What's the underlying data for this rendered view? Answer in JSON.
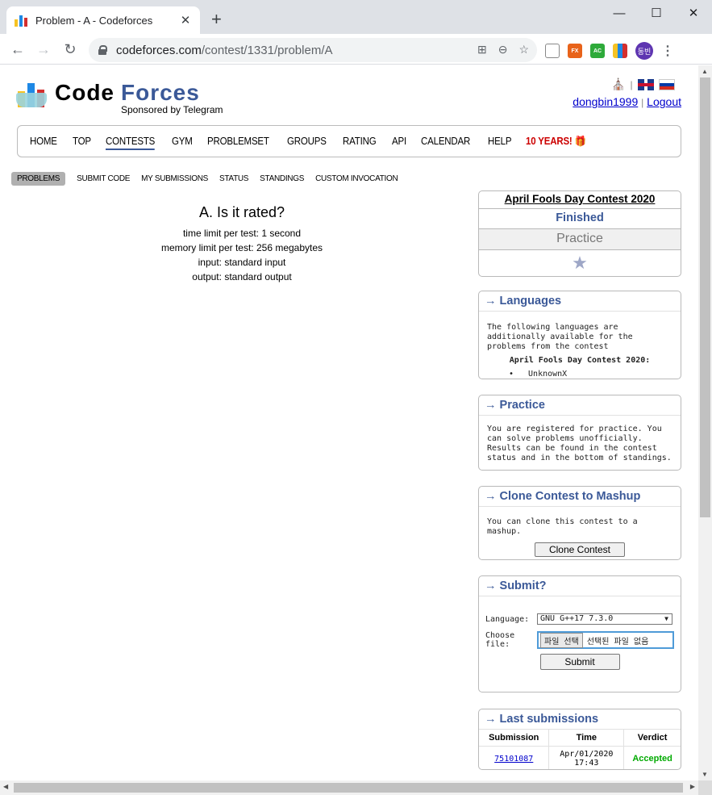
{
  "browser": {
    "tab_title": "Problem - A - Codeforces",
    "url_host": "codeforces.com",
    "url_path": "/contest/1331/problem/A",
    "profile_initials": "동빈",
    "ext_fx": "FX",
    "ext_ac": "AC"
  },
  "header": {
    "logo_code": "Code",
    "logo_forces": "Forces",
    "logo_sponsor": "Sponsored by Telegram",
    "separator": "|",
    "username": "dongbin1999",
    "logout": "Logout"
  },
  "main_menu": [
    "HOME",
    "TOP",
    "CONTESTS",
    "GYM",
    "PROBLEMSET",
    "GROUPS",
    "RATING",
    "API",
    "CALENDAR",
    "HELP"
  ],
  "main_menu_special": "10 YEARS! 🎁",
  "sub_menu": [
    "PROBLEMS",
    "SUBMIT CODE",
    "MY SUBMISSIONS",
    "STATUS",
    "STANDINGS",
    "CUSTOM INVOCATION"
  ],
  "problem": {
    "title": "A. Is it rated?",
    "time_limit": "time limit per test: 1 second",
    "memory_limit": "memory limit per test: 256 megabytes",
    "input": "input: standard input",
    "output": "output: standard output"
  },
  "contest_box": {
    "name": "April Fools Day Contest 2020",
    "status": "Finished",
    "phase": "Practice"
  },
  "languages_box": {
    "caption": "→ Languages",
    "text": "The following languages are additionally available for the problems from the contest",
    "subheading": "April Fools Day Contest 2020:",
    "item": "UnknownX"
  },
  "practice_box": {
    "caption": "→ Practice",
    "text": "You are registered for practice. You can solve problems unofficially. Results can be found in the contest status and in the bottom of standings."
  },
  "clone_box": {
    "caption": "→ Clone Contest to Mashup",
    "text": "You can clone this contest to a mashup.",
    "button": "Clone Contest"
  },
  "submit_box": {
    "caption": "→ Submit?",
    "language_label": "Language:",
    "language_value": "GNU G++17 7.3.0",
    "file_label": "Choose file:",
    "file_button": "파일 선택",
    "file_status": "선택된 파일 없음",
    "submit_button": "Submit"
  },
  "last_submissions": {
    "caption": "→ Last submissions",
    "headers": [
      "Submission",
      "Time",
      "Verdict"
    ],
    "rows": [
      {
        "id": "75101087",
        "time_date": "Apr/01/2020",
        "time_clock": "17:43",
        "verdict": "Accepted"
      }
    ]
  }
}
